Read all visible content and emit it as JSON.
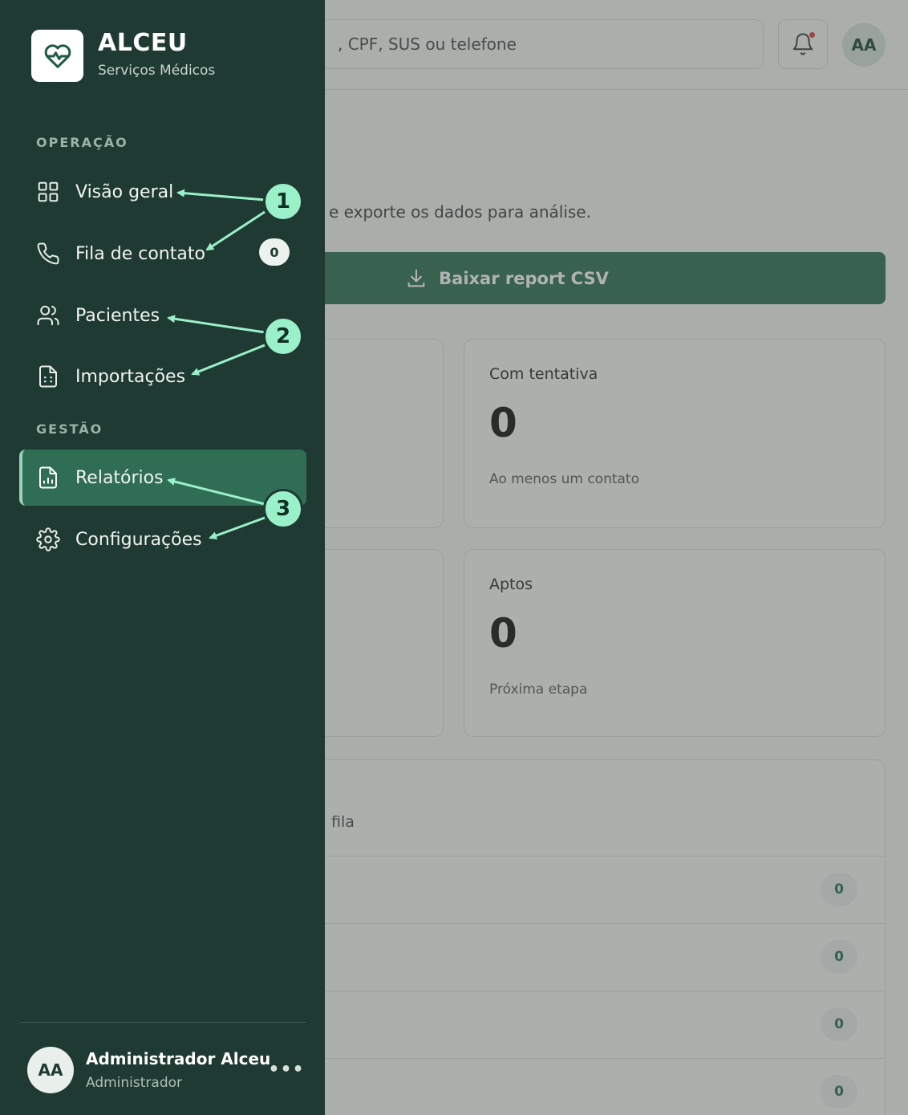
{
  "topbar": {
    "search_placeholder": ", CPF, SUS ou telefone",
    "avatar_initials": "AA"
  },
  "main": {
    "subtitle": "e exporte os dados para análise.",
    "csv_button": "Baixar report CSV",
    "cards": [
      {
        "title": "Com tentativa",
        "value": "0",
        "note": "Ao menos um contato"
      },
      {
        "title": "Aptos",
        "value": "0",
        "note": "Próxima etapa"
      }
    ],
    "list": {
      "header": "fila",
      "rows": [
        "0",
        "0",
        "0",
        "0"
      ]
    }
  },
  "sidebar": {
    "brand": "ALCEU",
    "brand_sub": "Serviços Médicos",
    "sections": [
      {
        "label": "OPERAÇÃO",
        "items": [
          {
            "label": "Visão geral",
            "icon": "grid-icon"
          },
          {
            "label": "Fila de contato",
            "icon": "phone-icon",
            "badge": "0"
          },
          {
            "label": "Pacientes",
            "icon": "users-icon"
          },
          {
            "label": "Importações",
            "icon": "file-icon"
          }
        ]
      },
      {
        "label": "GESTÃO",
        "items": [
          {
            "label": "Relatórios",
            "icon": "chart-file-icon",
            "active": true
          },
          {
            "label": "Configurações",
            "icon": "gear-icon"
          }
        ]
      }
    ],
    "user": {
      "initials": "AA",
      "name": "Administrador Alceu",
      "role": "Administrador"
    }
  },
  "callouts": [
    "1",
    "2",
    "3"
  ],
  "colors": {
    "sidebar": "#1f3a32",
    "active": "#2f6e55",
    "accent": "#9af0c9",
    "button": "#2f7355"
  }
}
